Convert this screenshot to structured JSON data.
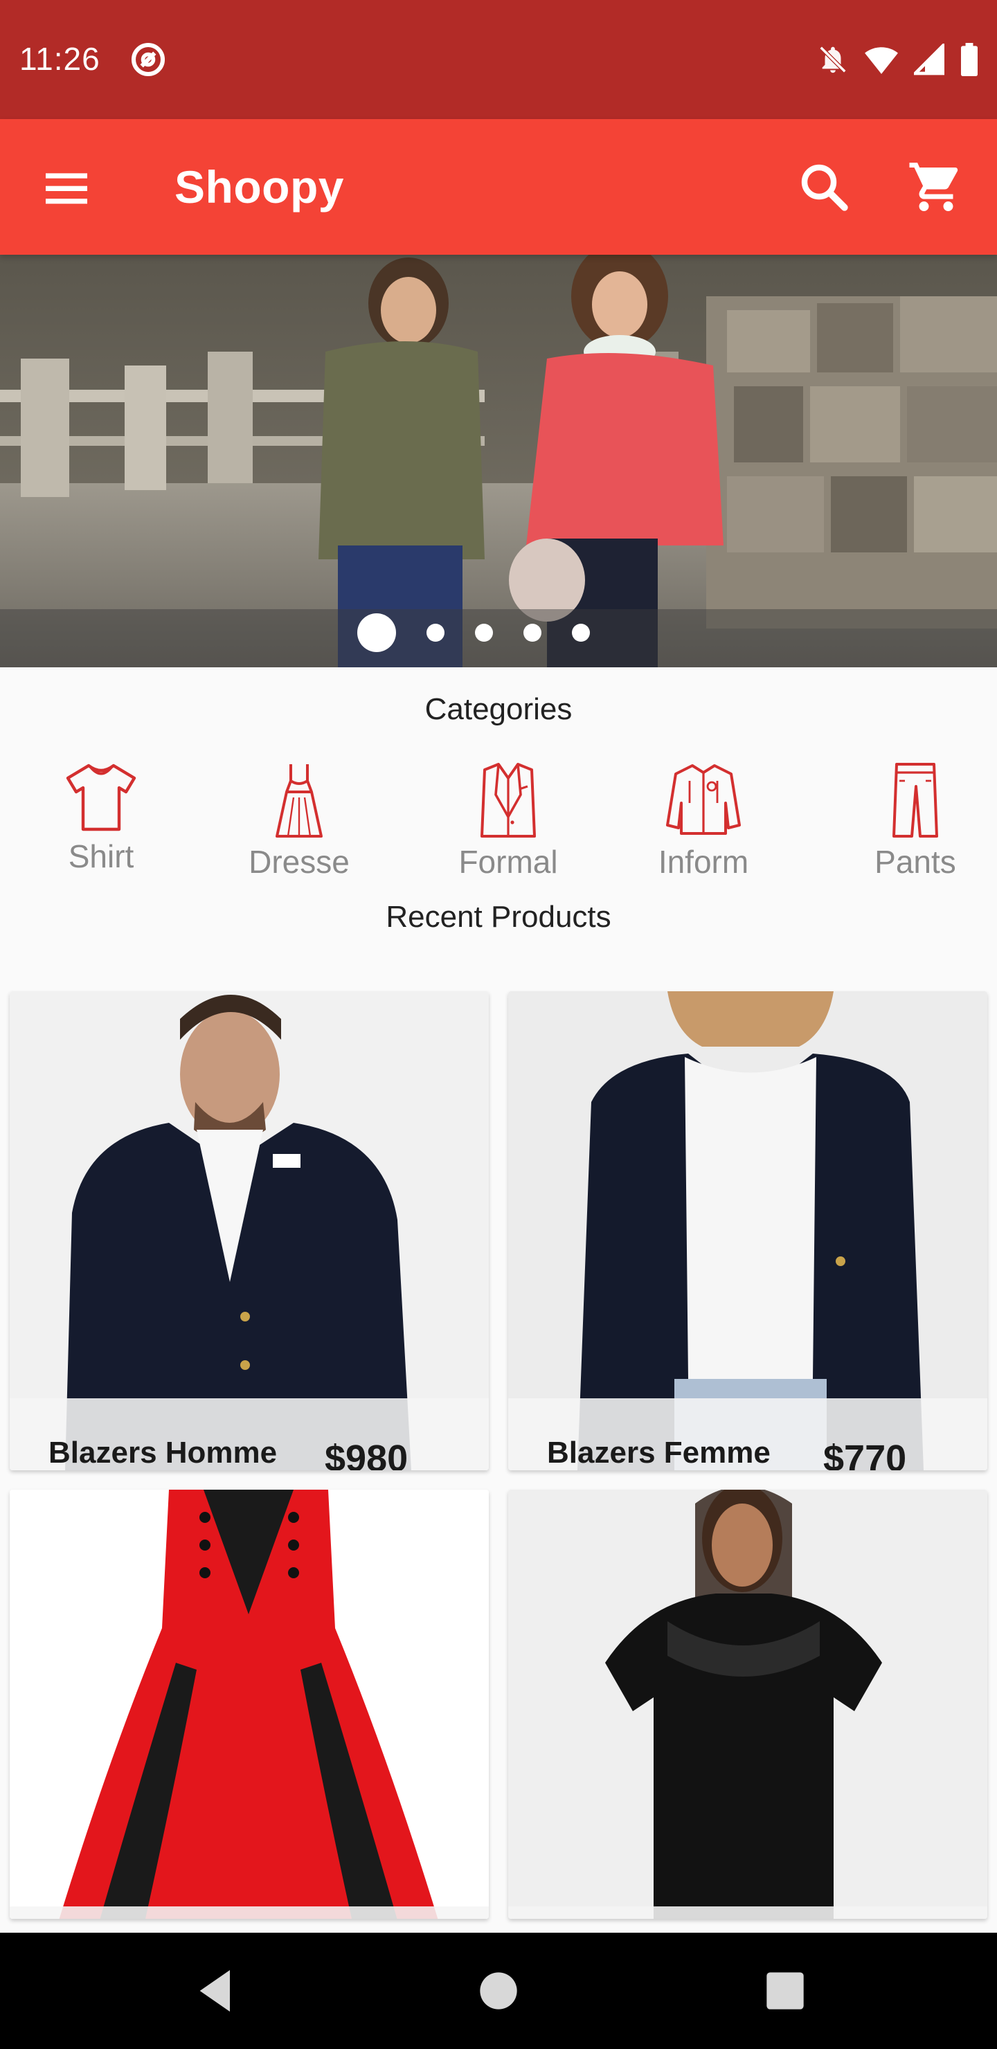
{
  "status_bar": {
    "time": "11:26"
  },
  "app_bar": {
    "title": "Shoopy"
  },
  "carousel": {
    "slide_count": 5,
    "active_index": 0
  },
  "categories": {
    "title": "Categories",
    "items": [
      {
        "label": "Shirt",
        "icon": "shirt-icon"
      },
      {
        "label": "Dresse",
        "icon": "dress-icon"
      },
      {
        "label": "Formal",
        "icon": "formal-icon"
      },
      {
        "label": "Inform",
        "icon": "jacket-icon"
      },
      {
        "label": "Pants",
        "icon": "pants-icon"
      }
    ]
  },
  "recent": {
    "title": "Recent Products",
    "products": [
      {
        "name": "Blazers Homme",
        "price": "$980"
      },
      {
        "name": "Blazers Femme",
        "price": "$770"
      },
      {
        "name": "",
        "price": ""
      },
      {
        "name": "",
        "price": ""
      }
    ]
  },
  "colors": {
    "primary": "#f44336",
    "primary_dark": "#b22b27",
    "icon_red": "#d32f2f"
  }
}
